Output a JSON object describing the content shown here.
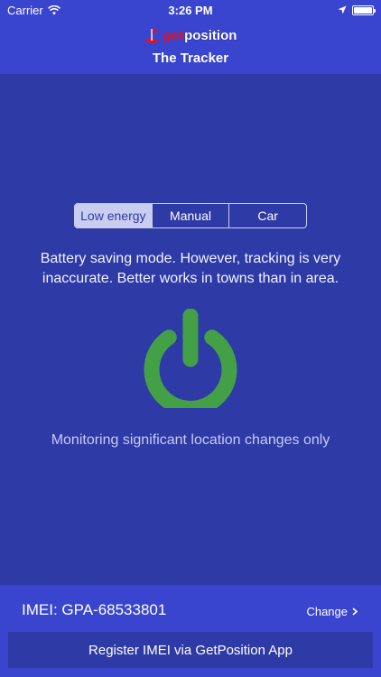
{
  "status_bar": {
    "carrier": "Carrier",
    "time": "3:26 PM",
    "icons": [
      "wifi-icon",
      "location-arrow-icon",
      "battery-icon"
    ]
  },
  "nav": {
    "logo_get": "get",
    "logo_position": "position",
    "title": "The Tracker"
  },
  "modes": {
    "options": [
      "Low energy",
      "Manual",
      "Car"
    ],
    "selected": "Low energy"
  },
  "description": "Battery saving mode. However, tracking is very inaccurate. Better works in towns than in area.",
  "power": {
    "icon": "power-icon",
    "color": "#43a047"
  },
  "status_message": "Monitoring significant location changes only",
  "imei": {
    "label": "IMEI: GPA-68533801",
    "change_label": "Change"
  },
  "register_label": "Register IMEI via GetPosition App",
  "colors": {
    "background": "#2e3aa6",
    "bar": "#3a45cf",
    "accent_green": "#43a047",
    "logo_red": "#e8101a"
  }
}
